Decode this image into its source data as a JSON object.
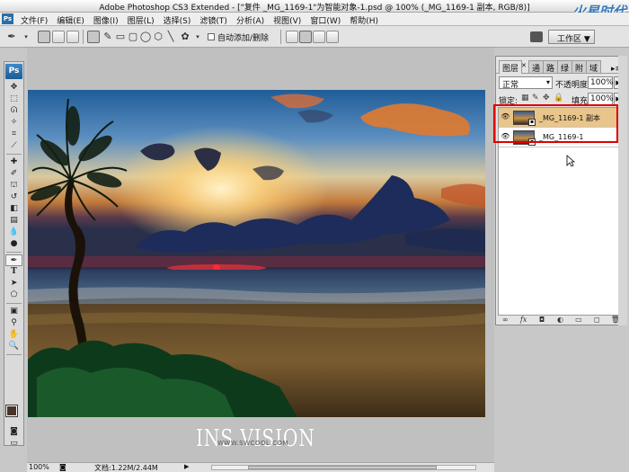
{
  "window": {
    "title": "Adobe Photoshop CS3 Extended - [\"复件 _MG_1169-1\"为智能对象-1.psd @ 100% (_MG_1169-1 副本, RGB/8)]",
    "logo_text": "火星时代"
  },
  "menu": {
    "items": [
      "文件(F)",
      "编辑(E)",
      "图像(I)",
      "图层(L)",
      "选择(S)",
      "滤镜(T)",
      "分析(A)",
      "视图(V)",
      "窗口(W)",
      "帮助(H)"
    ]
  },
  "options": {
    "auto_add_delete_label": "自动添加/删除",
    "workspace_label": "工作区 ▼"
  },
  "toolbox": {
    "logo": "Ps",
    "tools": [
      "move-icon",
      "marquee-icon",
      "lasso-icon",
      "magic-wand-icon",
      "crop-icon",
      "slice-icon",
      "healing-icon",
      "brush-icon",
      "stamp-icon",
      "history-brush-icon",
      "eraser-icon",
      "gradient-icon",
      "blur-icon",
      "dodge-icon",
      "pen-icon",
      "type-icon",
      "path-select-icon",
      "shape-icon",
      "notes-icon",
      "eyedropper-icon",
      "hand-icon",
      "zoom-icon"
    ],
    "foreground_color": "#4a3427",
    "background_color": "#0a0a0a"
  },
  "document": {
    "watermark": "INS VISION",
    "watermark_url": "WWW.SWCOOL.COM"
  },
  "status": {
    "zoom": "100%",
    "doc_size": "文档:1.22M/2.44M"
  },
  "layers_panel": {
    "tabs": [
      "图层",
      "通",
      "路",
      "绿",
      "附",
      "域"
    ],
    "blend_mode": "正常",
    "opacity_label": "不透明度:",
    "opacity_value": "100%",
    "lock_label": "锁定:",
    "fill_label": "填充:",
    "fill_value": "100%",
    "layers": [
      {
        "name": "_MG_1169-1 副本",
        "selected": true
      },
      {
        "name": "_MG_1169-1",
        "selected": false
      }
    ]
  },
  "colors": {
    "selection_highlight": "#e8c58a",
    "annotation_box": "#e00000"
  }
}
